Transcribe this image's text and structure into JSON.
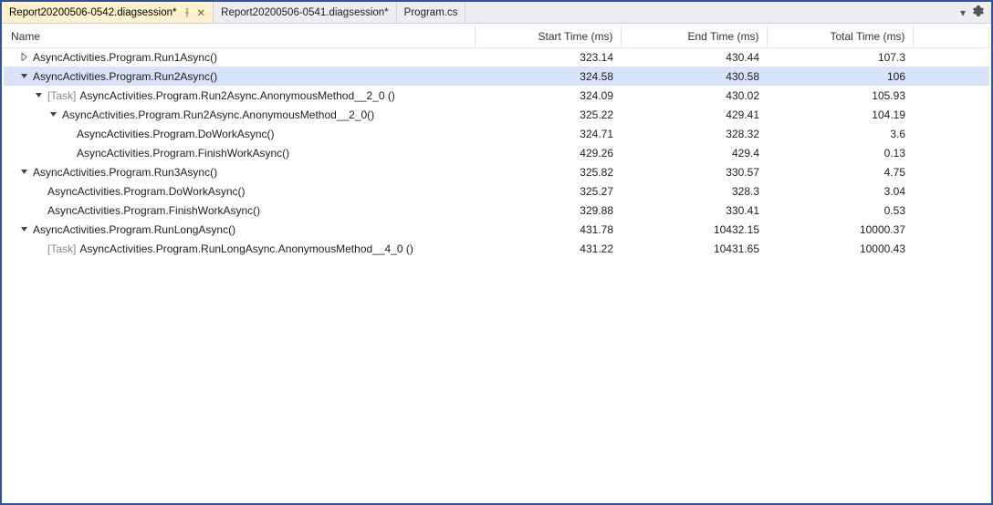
{
  "tabs": [
    {
      "label": "Report20200506-0542.diagsession*",
      "active": true,
      "pinned": true,
      "closeable": true
    },
    {
      "label": "Report20200506-0541.diagsession*",
      "active": false,
      "pinned": false,
      "closeable": false
    },
    {
      "label": "Program.cs",
      "active": false,
      "pinned": false,
      "closeable": false
    }
  ],
  "columns": {
    "name": "Name",
    "start": "Start Time (ms)",
    "end": "End Time (ms)",
    "total": "Total Time (ms)"
  },
  "rows": [
    {
      "indent": 0,
      "expander": "collapsed",
      "task": false,
      "name": "AsyncActivities.Program.Run1Async()",
      "start": "323.14",
      "end": "430.44",
      "total": "107.3",
      "selected": false
    },
    {
      "indent": 0,
      "expander": "expanded",
      "task": false,
      "name": "AsyncActivities.Program.Run2Async()",
      "start": "324.58",
      "end": "430.58",
      "total": "106",
      "selected": true
    },
    {
      "indent": 1,
      "expander": "expanded",
      "task": true,
      "name": "AsyncActivities.Program.Run2Async.AnonymousMethod__2_0 ()",
      "start": "324.09",
      "end": "430.02",
      "total": "105.93",
      "selected": false
    },
    {
      "indent": 2,
      "expander": "expanded",
      "task": false,
      "name": "AsyncActivities.Program.Run2Async.AnonymousMethod__2_0()",
      "start": "325.22",
      "end": "429.41",
      "total": "104.19",
      "selected": false
    },
    {
      "indent": 3,
      "expander": "none",
      "task": false,
      "name": "AsyncActivities.Program.DoWorkAsync()",
      "start": "324.71",
      "end": "328.32",
      "total": "3.6",
      "selected": false
    },
    {
      "indent": 3,
      "expander": "none",
      "task": false,
      "name": "AsyncActivities.Program.FinishWorkAsync()",
      "start": "429.26",
      "end": "429.4",
      "total": "0.13",
      "selected": false
    },
    {
      "indent": 0,
      "expander": "expanded",
      "task": false,
      "name": "AsyncActivities.Program.Run3Async()",
      "start": "325.82",
      "end": "330.57",
      "total": "4.75",
      "selected": false
    },
    {
      "indent": 1,
      "expander": "none",
      "task": false,
      "name": "AsyncActivities.Program.DoWorkAsync()",
      "start": "325.27",
      "end": "328.3",
      "total": "3.04",
      "selected": false
    },
    {
      "indent": 1,
      "expander": "none",
      "task": false,
      "name": "AsyncActivities.Program.FinishWorkAsync()",
      "start": "329.88",
      "end": "330.41",
      "total": "0.53",
      "selected": false
    },
    {
      "indent": 0,
      "expander": "expanded",
      "task": false,
      "name": "AsyncActivities.Program.RunLongAsync()",
      "start": "431.78",
      "end": "10432.15",
      "total": "10000.37",
      "selected": false
    },
    {
      "indent": 1,
      "expander": "none",
      "task": true,
      "name": "AsyncActivities.Program.RunLongAsync.AnonymousMethod__4_0 ()",
      "start": "431.22",
      "end": "10431.65",
      "total": "10000.43",
      "selected": false
    }
  ],
  "task_prefix": "[Task]"
}
